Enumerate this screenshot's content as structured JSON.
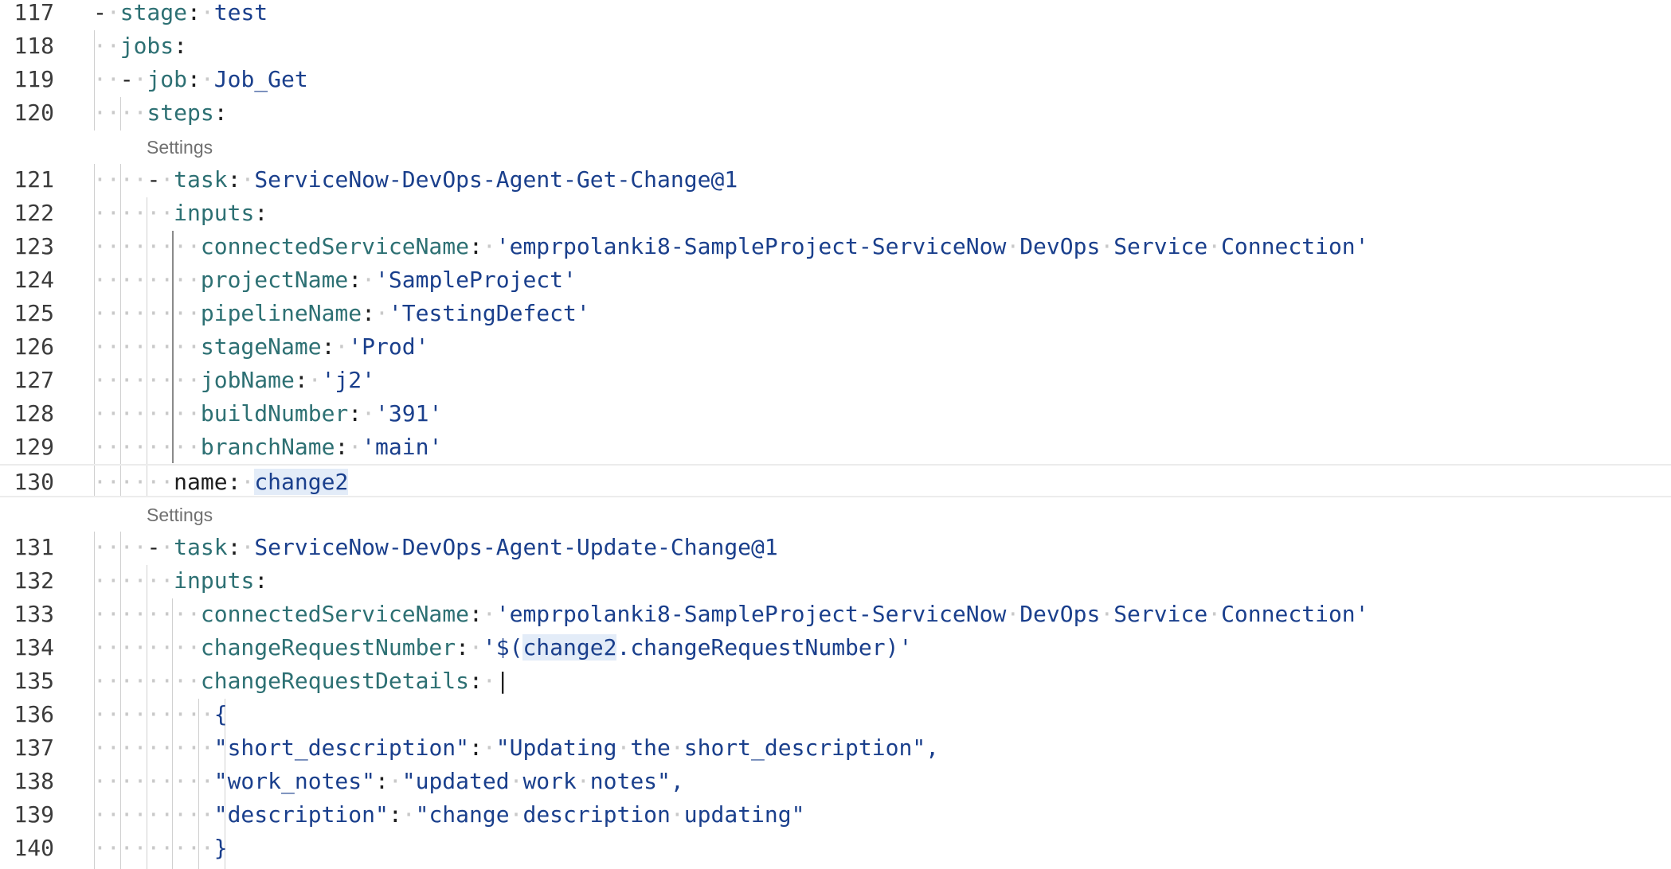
{
  "settings_label": "Settings",
  "lines": {
    "l117": {
      "num": "117",
      "c1": "stage",
      "c2": "test"
    },
    "l118": {
      "num": "118",
      "c1": "jobs"
    },
    "l119": {
      "num": "119",
      "c1": "job",
      "c2": "Job_Get"
    },
    "l120": {
      "num": "120",
      "c1": "steps"
    },
    "l121": {
      "num": "121",
      "c1": "task",
      "c2": "ServiceNow-DevOps-Agent-Get-Change@1"
    },
    "l122": {
      "num": "122",
      "c1": "inputs"
    },
    "l123": {
      "num": "123",
      "c1": "connectedServiceName",
      "c2": "'emprpolanki8-SampleProject-ServiceNow",
      "c3": "DevOps",
      "c4": "Service",
      "c5": "Connection'"
    },
    "l124": {
      "num": "124",
      "c1": "projectName",
      "c2": "'SampleProject'"
    },
    "l125": {
      "num": "125",
      "c1": "pipelineName",
      "c2": "'TestingDefect'"
    },
    "l126": {
      "num": "126",
      "c1": "stageName",
      "c2": "'Prod'"
    },
    "l127": {
      "num": "127",
      "c1": "jobName",
      "c2": "'j2'"
    },
    "l128": {
      "num": "128",
      "c1": "buildNumber",
      "c2": "'391'"
    },
    "l129": {
      "num": "129",
      "c1": "branchName",
      "c2": "'main'"
    },
    "l130": {
      "num": "130",
      "c1": "name",
      "c2": "change2"
    },
    "l131": {
      "num": "131",
      "c1": "task",
      "c2": "ServiceNow-DevOps-Agent-Update-Change@1"
    },
    "l132": {
      "num": "132",
      "c1": "inputs"
    },
    "l133": {
      "num": "133",
      "c1": "connectedServiceName",
      "c2": "'emprpolanki8-SampleProject-ServiceNow",
      "c3": "DevOps",
      "c4": "Service",
      "c5": "Connection'"
    },
    "l134": {
      "num": "134",
      "c1": "changeRequestNumber",
      "c2": "'$(",
      "c3": "change2",
      "c4": ".changeRequestNumber)'"
    },
    "l135": {
      "num": "135",
      "c1": "changeRequestDetails",
      "c2": "|"
    },
    "l136": {
      "num": "136",
      "c1": "{"
    },
    "l137": {
      "num": "137",
      "c1": "\"short_description\"",
      "c2": "\"Updating",
      "c3": "the",
      "c4": "short_description\","
    },
    "l138": {
      "num": "138",
      "c1": "\"work_notes\"",
      "c2": "\"updated",
      "c3": "work",
      "c4": "notes\","
    },
    "l139": {
      "num": "139",
      "c1": "\"description\"",
      "c2": "\"change",
      "c3": "description",
      "c4": "updating\""
    },
    "l140": {
      "num": "140",
      "c1": "}"
    }
  }
}
